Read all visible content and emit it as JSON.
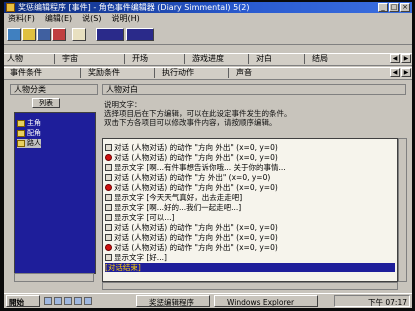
{
  "window": {
    "title": "奖惩编辑程序 [事件] - 角色事件编辑器 (Diary Simmental) 5(2)"
  },
  "menu": [
    "资料(F)",
    "编辑(E)",
    "说(S)",
    "说明(H)"
  ],
  "tabs_row1": [
    "人物",
    "宇宙",
    "开场",
    "游戏进度",
    "对白",
    "结局"
  ],
  "tabs_row2": [
    "事件条件",
    "奖励条件",
    "执行动作",
    "声音"
  ],
  "left_panel": {
    "header": "人物分类",
    "button": "列表",
    "tree": [
      "主角",
      "配角",
      "路人"
    ]
  },
  "right_panel": {
    "header": "人物对白",
    "description": [
      "说明文字：",
      "选择项目后在下方编辑，可以在此设定事件发生的条件。",
      "双击下方各项目可以修改事件内容，请按顺序编辑。"
    ],
    "rows": [
      {
        "text": "对话  (人物对话)  的动作  \"方向  外出\"     (x=0, y=0)",
        "marker": "box"
      },
      {
        "text": "对话  (人物对话)  的动作  \"方向  外出\"     (x=0, y=0)",
        "marker": "red"
      },
      {
        "text": "显示文字  [啊...有件事想告诉你哦...  关于你的事情...",
        "marker": "box"
      },
      {
        "text": "对话  (人物对话)  的动作  \"方  外出\"     (x=0, y=0)",
        "marker": "box"
      },
      {
        "text": "对话  (人物对话)  的动作  \"方向  外出\"     (x=0, y=0)",
        "marker": "red"
      },
      {
        "text": "显示文字  [今天天气真好，出去走走吧]",
        "marker": "box"
      },
      {
        "text": "显示文字  [啊...好的...我们一起走吧...]",
        "marker": "box"
      },
      {
        "text": "显示文字  [可以...]",
        "marker": "box"
      },
      {
        "text": "对话  (人物对话)  的动作  \"方向  外出\"     (x=0, y=0)",
        "marker": "box"
      },
      {
        "text": "对话  (人物对话)  的动作  \"方向  外出\"     (x=0, y=0)",
        "marker": "box"
      },
      {
        "text": "对话  (人物对话)  的动作  \"方向  外出\"     (x=0, y=0)",
        "marker": "red"
      },
      {
        "text": "显示文字  [好...]",
        "marker": "box"
      },
      {
        "text": "[对话结束]",
        "marker": "none",
        "highlight": true
      }
    ]
  },
  "taskbar": {
    "start": "開始",
    "tasks": [
      "奖惩编辑程序",
      "Windows Explorer"
    ],
    "clock": "下午 07:17"
  }
}
